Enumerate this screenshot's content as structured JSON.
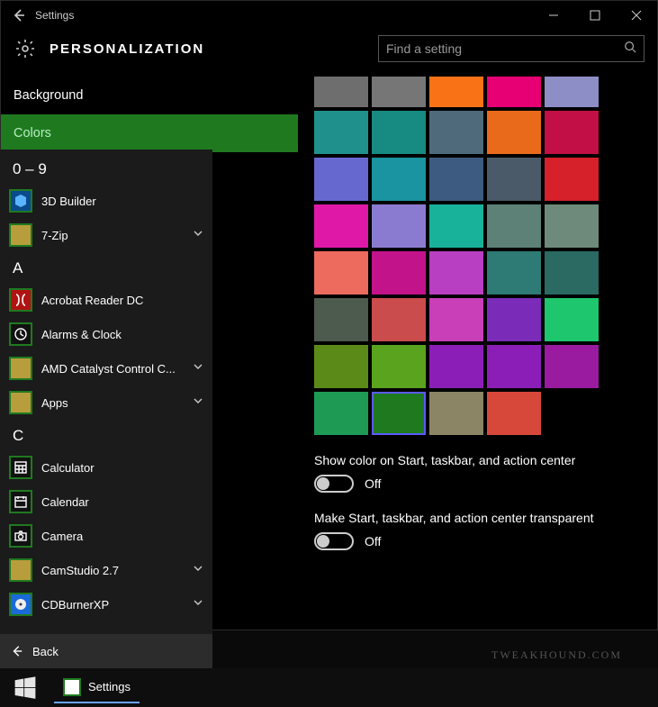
{
  "window": {
    "title": "Settings",
    "page_heading": "PERSONALIZATION"
  },
  "search": {
    "placeholder": "Find a setting"
  },
  "nav": {
    "items": [
      "Background",
      "Colors"
    ],
    "active_index": 1
  },
  "colors": {
    "swatches": [
      [
        "#6e6e6e",
        "#767676",
        "#f97316",
        "#e60073",
        "#8e8ec7"
      ],
      [
        "#20908c",
        "#178a82",
        "#4f6a7a",
        "#ea6a1c",
        "#c20f46"
      ],
      [
        "#6767d0",
        "#1994a0",
        "#3d5b80",
        "#4a5a68",
        "#d6202a"
      ],
      [
        "#e018a8",
        "#8a7bd1",
        "#18b29a",
        "#5d8176",
        "#6e8a7a"
      ],
      [
        "#ec6a5e",
        "#c2138b",
        "#b83fc1",
        "#2e7a74",
        "#2a6a63"
      ],
      [
        "#4d5a4e",
        "#cb4c4c",
        "#c93fb8",
        "#7a2cb8",
        "#1ec76d"
      ],
      [
        "#5c8a18",
        "#5aa31e",
        "#8c1eb8",
        "#8c1eb8",
        "#9a1ba0"
      ],
      [
        "#1e9a55",
        "#1f7a1f",
        "#8c8565",
        "#d8483a",
        ""
      ]
    ],
    "selected": {
      "row": 7,
      "col": 1
    }
  },
  "toggles": {
    "show_color": {
      "label": "Show color on Start, taskbar, and action center",
      "state": "Off"
    },
    "transparent": {
      "label": "Make Start, taskbar, and action center transparent",
      "state": "Off"
    }
  },
  "start": {
    "groups": [
      {
        "header": "0 – 9",
        "apps": [
          {
            "label": "3D Builder",
            "icon": "cube",
            "bg": "#0a4b8c",
            "expandable": false
          },
          {
            "label": "7-Zip",
            "icon": "folder",
            "expandable": true
          }
        ]
      },
      {
        "header": "A",
        "apps": [
          {
            "label": "Acrobat Reader DC",
            "icon": "acrobat",
            "bg": "#b11313",
            "expandable": false
          },
          {
            "label": "Alarms & Clock",
            "icon": "clock",
            "bg": "#111",
            "expandable": false
          },
          {
            "label": "AMD Catalyst Control C...",
            "icon": "folder",
            "expandable": true
          },
          {
            "label": "Apps",
            "icon": "folder",
            "expandable": true
          }
        ]
      },
      {
        "header": "C",
        "apps": [
          {
            "label": "Calculator",
            "icon": "calc",
            "bg": "#111",
            "expandable": false
          },
          {
            "label": "Calendar",
            "icon": "calendar",
            "bg": "#111",
            "expandable": false
          },
          {
            "label": "Camera",
            "icon": "camera",
            "bg": "#111",
            "expandable": false
          },
          {
            "label": "CamStudio 2.7",
            "icon": "folder",
            "expandable": true
          },
          {
            "label": "CDBurnerXP",
            "icon": "cd",
            "bg": "#1a6bd8",
            "expandable": true
          }
        ]
      }
    ],
    "back_label": "Back"
  },
  "taskbar": {
    "active_app": "Settings"
  },
  "watermark": "TWEAKHOUND.COM"
}
